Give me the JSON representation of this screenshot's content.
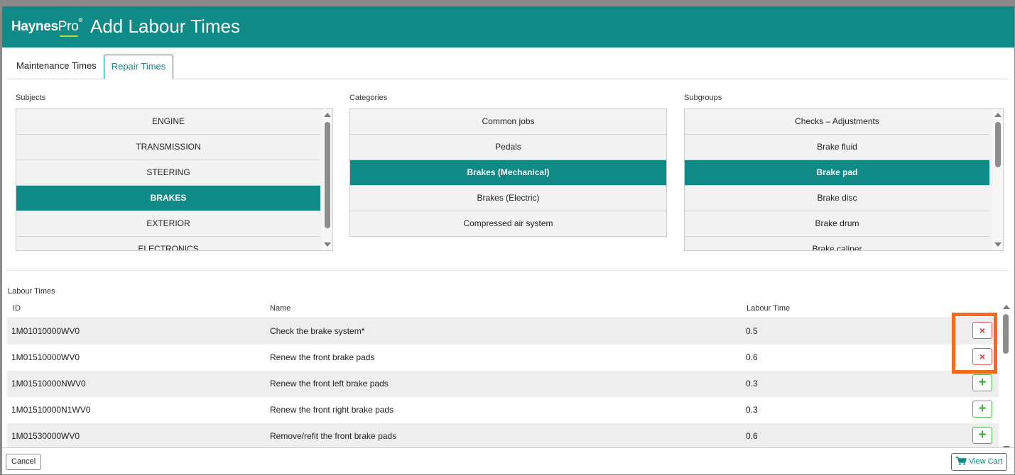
{
  "header": {
    "logo_bold": "Haynes",
    "logo_light": "Pro",
    "logo_mark": "®",
    "title": "Add Labour Times"
  },
  "tabs": [
    {
      "label": "Maintenance Times"
    },
    {
      "label": "Repair Times",
      "active": true
    }
  ],
  "subjects": {
    "label": "Subjects",
    "items": [
      "ENGINE",
      "TRANSMISSION",
      "STEERING",
      "BRAKES",
      "EXTERIOR",
      "ELECTRONICS"
    ],
    "selected": "BRAKES"
  },
  "categories": {
    "label": "Categories",
    "items": [
      "Common jobs",
      "Pedals",
      "Brakes (Mechanical)",
      "Brakes (Electric)",
      "Compressed air system"
    ],
    "selected": "Brakes (Mechanical)"
  },
  "subgroups": {
    "label": "Subgroups",
    "items": [
      "Checks – Adjustments",
      "Brake fluid",
      "Brake pad",
      "Brake disc",
      "Brake drum",
      "Brake caliper"
    ],
    "selected": "Brake pad"
  },
  "labour_times": {
    "label": "Labour Times",
    "columns": {
      "id": "ID",
      "name": "Name",
      "time": "Labour Time"
    },
    "rows": [
      {
        "id": "1M01010000WV0",
        "name": "Check the brake system*",
        "time": "0.5",
        "action": "remove"
      },
      {
        "id": "1M01510000WV0",
        "name": "Renew the front brake pads",
        "time": "0.6",
        "action": "remove"
      },
      {
        "id": "1M01510000NWV0",
        "name": "Renew the front left brake pads",
        "time": "0.3",
        "action": "add"
      },
      {
        "id": "1M01510000N1WV0",
        "name": "Renew the front right brake pads",
        "time": "0.3",
        "action": "add"
      },
      {
        "id": "1M01530000WV0",
        "name": "Remove/refit the front brake pads",
        "time": "0.6",
        "action": "add"
      }
    ]
  },
  "footer": {
    "cancel_label": "Cancel",
    "cart_label": "View Cart"
  },
  "colors": {
    "brand": "#0f8a86",
    "highlight": "#f26a1b",
    "remove": "#d83c3c",
    "add": "#43a843"
  },
  "icons": {
    "remove": "×",
    "add": "+",
    "cart": "cart-icon"
  }
}
